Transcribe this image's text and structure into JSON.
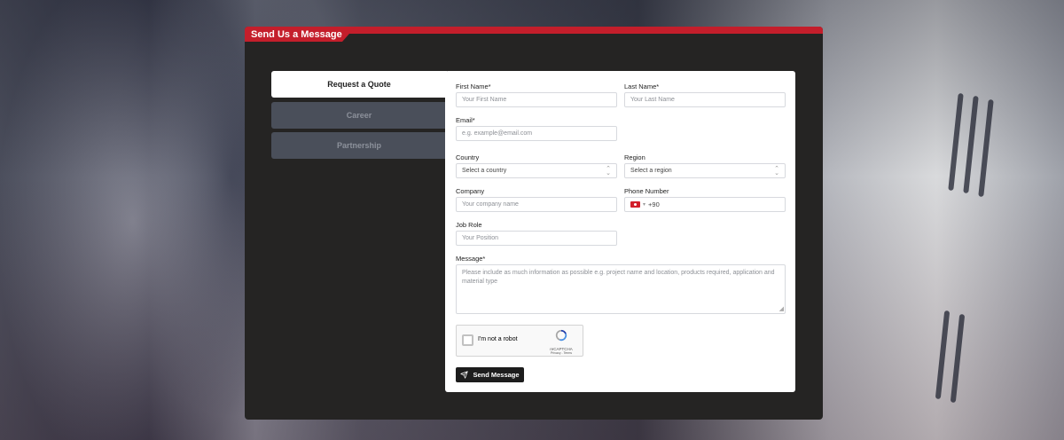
{
  "panel": {
    "title": "Send Us a Message"
  },
  "tabs": [
    {
      "label": "Request a Quote",
      "active": true
    },
    {
      "label": "Career",
      "active": false
    },
    {
      "label": "Partnership",
      "active": false
    }
  ],
  "form": {
    "first_name": {
      "label": "First Name*",
      "placeholder": "Your First Name"
    },
    "last_name": {
      "label": "Last Name*",
      "placeholder": "Your Last Name"
    },
    "email": {
      "label": "Email*",
      "placeholder": "e.g. example@email.com"
    },
    "country": {
      "label": "Country",
      "selected": "Select a country"
    },
    "region": {
      "label": "Region",
      "selected": "Select a region"
    },
    "company": {
      "label": "Company",
      "placeholder": "Your company name"
    },
    "phone": {
      "label": "Phone Number",
      "value": "+90",
      "flag": "tr-flag-icon"
    },
    "job_role": {
      "label": "Job Role",
      "placeholder": "Your Position"
    },
    "message": {
      "label": "Message*",
      "placeholder": "Please include as much information as possible e.g. project name and location, products required, application and material type"
    },
    "captcha": {
      "label": "I'm not a robot",
      "brand": "reCAPTCHA",
      "links": "Privacy - Terms"
    },
    "submit_label": "Send Message"
  },
  "colors": {
    "accent": "#c41e2b",
    "panel_bg": "#252423",
    "button": "#1d1d1d"
  }
}
